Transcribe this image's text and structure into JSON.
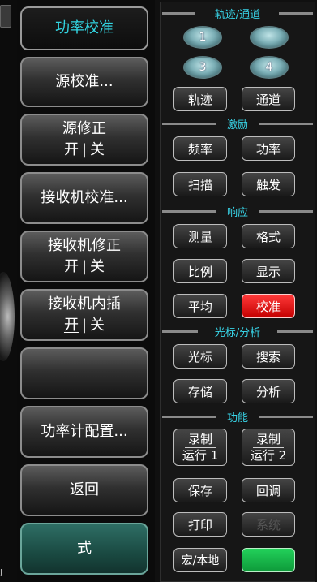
{
  "left_strip": {
    "corner_char": "J"
  },
  "softkeys": [
    {
      "label": "功率校准",
      "active": true
    },
    {
      "label": "源校准..."
    },
    {
      "label": "源修正",
      "on": "开",
      "sep": "|",
      "off": "关"
    },
    {
      "label": "接收机校准..."
    },
    {
      "label": "接收机修正",
      "on": "开",
      "sep": "|",
      "off": "关"
    },
    {
      "label": "接收机内插",
      "on": "开",
      "sep": "|",
      "off": "关"
    },
    {
      "label": ""
    },
    {
      "label": "功率计配置..."
    },
    {
      "label": "返回"
    },
    {
      "label": "式"
    }
  ],
  "hardkeys": {
    "trace_channel": {
      "title": "轨迹/通道",
      "ovals": [
        "1",
        "",
        "3",
        "4"
      ],
      "trace": "轨迹",
      "channel": "通道"
    },
    "stimulus": {
      "title": "激励",
      "freq": "频率",
      "power": "功率",
      "sweep": "扫描",
      "trigger": "触发"
    },
    "response": {
      "title": "响应",
      "measure": "测量",
      "format": "格式",
      "scale": "比例",
      "display": "显示",
      "average": "平均",
      "cal": "校准"
    },
    "marker": {
      "title": "光标/分析",
      "marker": "光标",
      "search": "搜索",
      "memory": "存储",
      "analysis": "分析"
    },
    "utility": {
      "title": "功能",
      "rec1_top": "录制",
      "rec1_bottom": "运行 1",
      "rec2_top": "录制",
      "rec2_bottom": "运行 2",
      "save": "保存",
      "recall": "回调",
      "print": "打印",
      "system": "系统",
      "macro": "宏/本地",
      "preset": ""
    }
  },
  "colors": {
    "accent": "#38d3e6",
    "cal_red": "#e60000",
    "preset_green": "#19b84a"
  }
}
